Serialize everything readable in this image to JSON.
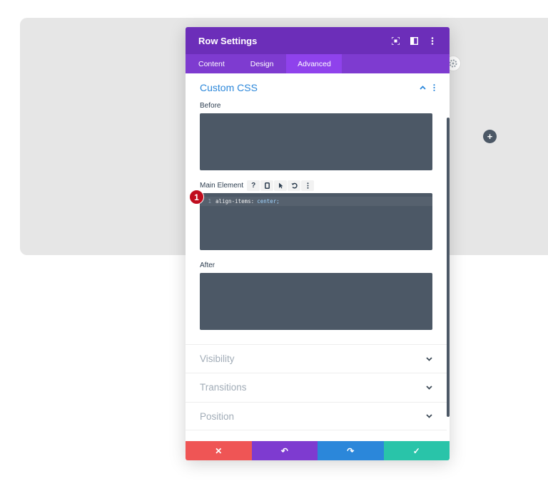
{
  "modal": {
    "title": "Row Settings",
    "header_icons": [
      "fullscreen-icon",
      "sidebar-icon",
      "more-icon"
    ]
  },
  "tabs": [
    {
      "label": "Content",
      "active": false
    },
    {
      "label": "Design",
      "active": false
    },
    {
      "label": "Advanced",
      "active": true
    }
  ],
  "section": {
    "title": "Custom CSS",
    "expanded": true
  },
  "fields": {
    "before_label": "Before",
    "main_element_label": "Main Element",
    "main_element_icons": [
      "?",
      "phone-icon",
      "pointer-icon",
      "undo-icon",
      "more-icon"
    ],
    "after_label": "After"
  },
  "code": {
    "line_number": "1",
    "property": "align-items",
    "colon": ":",
    "value": "center;"
  },
  "annotation": {
    "marker": "1",
    "color": "#c00d1e"
  },
  "collapsed_sections": [
    {
      "title": "Visibility"
    },
    {
      "title": "Transitions"
    },
    {
      "title": "Position"
    }
  ],
  "footer": {
    "buttons": [
      {
        "name": "discard",
        "glyph": "✕",
        "color": "#ef5555"
      },
      {
        "name": "undo",
        "glyph": "↶",
        "color": "#7e3bd0"
      },
      {
        "name": "redo",
        "glyph": "↷",
        "color": "#2b87da"
      },
      {
        "name": "save",
        "glyph": "✓",
        "color": "#29c4a9"
      }
    ]
  },
  "background": {
    "add_button_glyph": "+"
  },
  "colors": {
    "header": "#6c2eb9",
    "tabs": "#7e3bd0",
    "active_tab": "#8f42ec",
    "accent": "#2b87da",
    "code_bg": "#4c5866"
  }
}
